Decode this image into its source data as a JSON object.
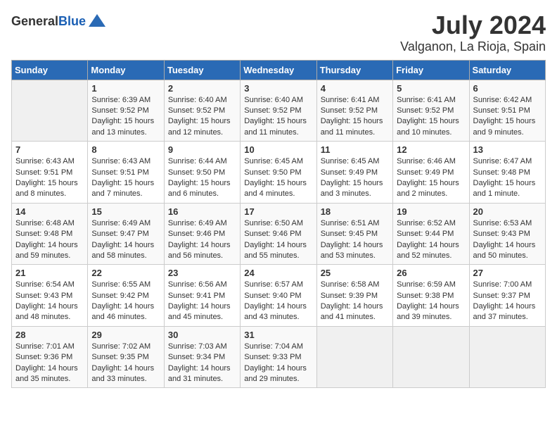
{
  "header": {
    "logo_general": "General",
    "logo_blue": "Blue",
    "month": "July 2024",
    "location": "Valganon, La Rioja, Spain"
  },
  "weekdays": [
    "Sunday",
    "Monday",
    "Tuesday",
    "Wednesday",
    "Thursday",
    "Friday",
    "Saturday"
  ],
  "weeks": [
    [
      {
        "day": "",
        "info": ""
      },
      {
        "day": "1",
        "info": "Sunrise: 6:39 AM\nSunset: 9:52 PM\nDaylight: 15 hours\nand 13 minutes."
      },
      {
        "day": "2",
        "info": "Sunrise: 6:40 AM\nSunset: 9:52 PM\nDaylight: 15 hours\nand 12 minutes."
      },
      {
        "day": "3",
        "info": "Sunrise: 6:40 AM\nSunset: 9:52 PM\nDaylight: 15 hours\nand 11 minutes."
      },
      {
        "day": "4",
        "info": "Sunrise: 6:41 AM\nSunset: 9:52 PM\nDaylight: 15 hours\nand 11 minutes."
      },
      {
        "day": "5",
        "info": "Sunrise: 6:41 AM\nSunset: 9:52 PM\nDaylight: 15 hours\nand 10 minutes."
      },
      {
        "day": "6",
        "info": "Sunrise: 6:42 AM\nSunset: 9:51 PM\nDaylight: 15 hours\nand 9 minutes."
      }
    ],
    [
      {
        "day": "7",
        "info": "Sunrise: 6:43 AM\nSunset: 9:51 PM\nDaylight: 15 hours\nand 8 minutes."
      },
      {
        "day": "8",
        "info": "Sunrise: 6:43 AM\nSunset: 9:51 PM\nDaylight: 15 hours\nand 7 minutes."
      },
      {
        "day": "9",
        "info": "Sunrise: 6:44 AM\nSunset: 9:50 PM\nDaylight: 15 hours\nand 6 minutes."
      },
      {
        "day": "10",
        "info": "Sunrise: 6:45 AM\nSunset: 9:50 PM\nDaylight: 15 hours\nand 4 minutes."
      },
      {
        "day": "11",
        "info": "Sunrise: 6:45 AM\nSunset: 9:49 PM\nDaylight: 15 hours\nand 3 minutes."
      },
      {
        "day": "12",
        "info": "Sunrise: 6:46 AM\nSunset: 9:49 PM\nDaylight: 15 hours\nand 2 minutes."
      },
      {
        "day": "13",
        "info": "Sunrise: 6:47 AM\nSunset: 9:48 PM\nDaylight: 15 hours\nand 1 minute."
      }
    ],
    [
      {
        "day": "14",
        "info": "Sunrise: 6:48 AM\nSunset: 9:48 PM\nDaylight: 14 hours\nand 59 minutes."
      },
      {
        "day": "15",
        "info": "Sunrise: 6:49 AM\nSunset: 9:47 PM\nDaylight: 14 hours\nand 58 minutes."
      },
      {
        "day": "16",
        "info": "Sunrise: 6:49 AM\nSunset: 9:46 PM\nDaylight: 14 hours\nand 56 minutes."
      },
      {
        "day": "17",
        "info": "Sunrise: 6:50 AM\nSunset: 9:46 PM\nDaylight: 14 hours\nand 55 minutes."
      },
      {
        "day": "18",
        "info": "Sunrise: 6:51 AM\nSunset: 9:45 PM\nDaylight: 14 hours\nand 53 minutes."
      },
      {
        "day": "19",
        "info": "Sunrise: 6:52 AM\nSunset: 9:44 PM\nDaylight: 14 hours\nand 52 minutes."
      },
      {
        "day": "20",
        "info": "Sunrise: 6:53 AM\nSunset: 9:43 PM\nDaylight: 14 hours\nand 50 minutes."
      }
    ],
    [
      {
        "day": "21",
        "info": "Sunrise: 6:54 AM\nSunset: 9:43 PM\nDaylight: 14 hours\nand 48 minutes."
      },
      {
        "day": "22",
        "info": "Sunrise: 6:55 AM\nSunset: 9:42 PM\nDaylight: 14 hours\nand 46 minutes."
      },
      {
        "day": "23",
        "info": "Sunrise: 6:56 AM\nSunset: 9:41 PM\nDaylight: 14 hours\nand 45 minutes."
      },
      {
        "day": "24",
        "info": "Sunrise: 6:57 AM\nSunset: 9:40 PM\nDaylight: 14 hours\nand 43 minutes."
      },
      {
        "day": "25",
        "info": "Sunrise: 6:58 AM\nSunset: 9:39 PM\nDaylight: 14 hours\nand 41 minutes."
      },
      {
        "day": "26",
        "info": "Sunrise: 6:59 AM\nSunset: 9:38 PM\nDaylight: 14 hours\nand 39 minutes."
      },
      {
        "day": "27",
        "info": "Sunrise: 7:00 AM\nSunset: 9:37 PM\nDaylight: 14 hours\nand 37 minutes."
      }
    ],
    [
      {
        "day": "28",
        "info": "Sunrise: 7:01 AM\nSunset: 9:36 PM\nDaylight: 14 hours\nand 35 minutes."
      },
      {
        "day": "29",
        "info": "Sunrise: 7:02 AM\nSunset: 9:35 PM\nDaylight: 14 hours\nand 33 minutes."
      },
      {
        "day": "30",
        "info": "Sunrise: 7:03 AM\nSunset: 9:34 PM\nDaylight: 14 hours\nand 31 minutes."
      },
      {
        "day": "31",
        "info": "Sunrise: 7:04 AM\nSunset: 9:33 PM\nDaylight: 14 hours\nand 29 minutes."
      },
      {
        "day": "",
        "info": ""
      },
      {
        "day": "",
        "info": ""
      },
      {
        "day": "",
        "info": ""
      }
    ]
  ]
}
